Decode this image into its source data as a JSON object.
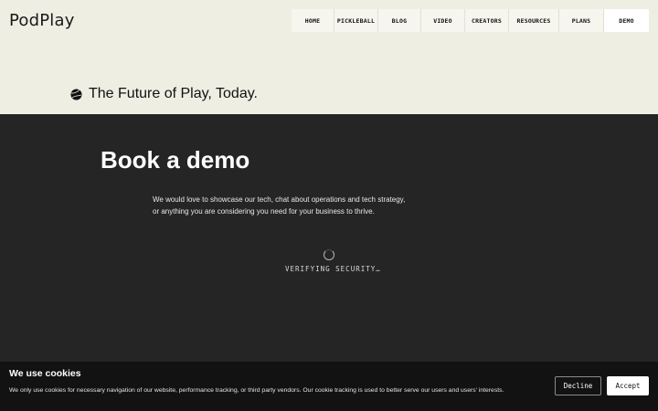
{
  "header": {
    "logo": "PodPlay",
    "nav": [
      {
        "label": "HOME",
        "active": false
      },
      {
        "label": "PICKLEBALL",
        "active": false
      },
      {
        "label": "BLOG",
        "active": false
      },
      {
        "label": "VIDEO",
        "active": false
      },
      {
        "label": "CREATORS",
        "active": false
      },
      {
        "label": "RESOURCES",
        "active": false
      },
      {
        "label": "PLANS",
        "active": false
      },
      {
        "label": "DEMO",
        "active": true
      }
    ]
  },
  "tagline": {
    "icon": "ball-icon",
    "text": "The Future of Play, Today."
  },
  "main": {
    "title": "Book a demo",
    "description_lines": [
      "We would love to showcase our tech, chat about operations and tech strategy,",
      "or anything you are considering you need for your business to thrive."
    ],
    "status": "VERIFYING SECURITY…"
  },
  "cookie_banner": {
    "title": "We use cookies",
    "text": "We only use cookies for necessary navigation of our website, performance tracking, or third party vendors. Our cookie tracking is used to better serve our users and users' interests.",
    "decline_label": "Decline",
    "accept_label": "Accept"
  },
  "colors": {
    "light_bg": "#efeee3",
    "dark_bg": "#252525",
    "banner_bg": "#121212"
  }
}
